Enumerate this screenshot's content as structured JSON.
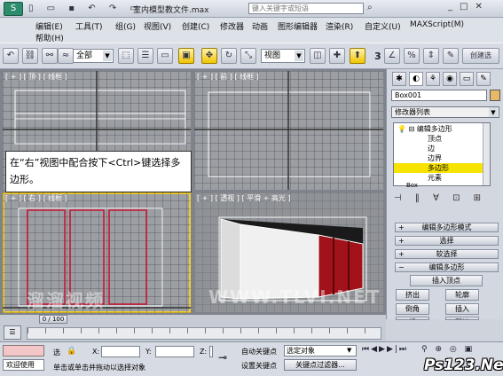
{
  "window": {
    "title": "室内模型教文件.max",
    "search_placeholder": "键入关键字或短语"
  },
  "menu": [
    "编辑(E)",
    "工具(T)",
    "组(G)",
    "视图(V)",
    "创建(C)",
    "修改器",
    "动画",
    "图形编辑器",
    "渲染(R)",
    "自定义(U)",
    "MAXScript(M)",
    "帮助(H)"
  ],
  "toolbar": {
    "selection_filter": "全部",
    "ref_coord": "视图",
    "snap_value": "3"
  },
  "viewports": [
    {
      "id": "top",
      "label": "[ + ] [ 顶 ] [ 线框 ]"
    },
    {
      "id": "front",
      "label": "[ + ] [ 前 ] [ 线框 ]"
    },
    {
      "id": "right",
      "label": "[ + ] [ 右 ] [ 线框 ]"
    },
    {
      "id": "perspective",
      "label": "[ + ] [ 透视 ] [ 平滑 + 高光 ]"
    }
  ],
  "callout": "在“右”视图中配合按下<Ctrl>键选择多边形。",
  "command_panel": {
    "object_name": "Box001",
    "modifier_list": "修改器列表",
    "stack": [
      "编辑多边形",
      "顶点",
      "边",
      "边界",
      "多边形",
      "元素",
      "Box"
    ],
    "stack_selected": 4,
    "rollouts": [
      "编辑多边形模式",
      "选择",
      "软选择",
      "编辑多边形"
    ],
    "buttons": [
      "插入顶点",
      "挤出",
      "轮廓",
      "倒角",
      "插入",
      "桥",
      "翻转"
    ]
  },
  "timeline": {
    "frame": "0 / 100"
  },
  "status": {
    "mini_listener": "欢迎使用",
    "selected_label": "选",
    "x_label": "X:",
    "y_label": "Y:",
    "z_label": "Z:",
    "auto_key": "自动关键点",
    "set_key": "设置关键点",
    "key_mode_select": "选定对象",
    "key_filters": "关键点过滤器...",
    "prompt": "单击或单击并拖动以选择对象"
  },
  "watermarks": {
    "left": "溜溜视频",
    "center": "WWW.TLVI.NET",
    "corner": "Ps123.Net"
  }
}
